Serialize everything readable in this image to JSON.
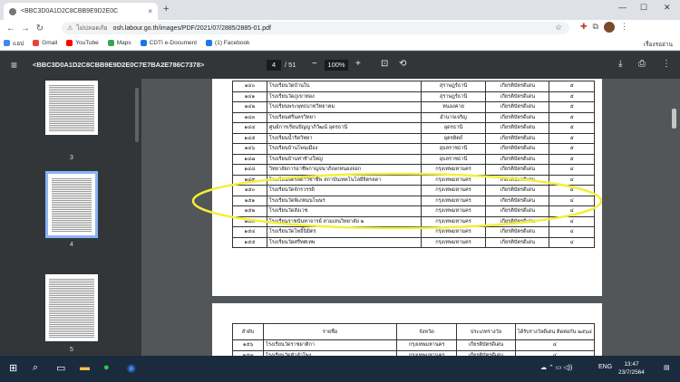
{
  "browser": {
    "tab_title": "<BBC3D0A1D2C8CBB9E9D2E0C",
    "tab_close": "×",
    "new_tab": "+",
    "win_min": "—",
    "win_max": "☐",
    "win_close": "✕",
    "back": "←",
    "forward": "→",
    "reload": "↻",
    "security_label": "ไม่ปลอดภัย",
    "url": "osh.labour.go.th/images/PDF/2021/07/2885/2885-01.pdf",
    "star": "☆"
  },
  "bookmarks": [
    {
      "label": "แอป",
      "color": "#4285f4"
    },
    {
      "label": "Gmail",
      "color": "#ea4335"
    },
    {
      "label": "YouTube",
      "color": "#ff0000"
    },
    {
      "label": "Maps",
      "color": "#34a853"
    },
    {
      "label": "CDTI e-Document",
      "color": "#1a73e8"
    },
    {
      "label": "(1) Facebook",
      "color": "#1877f2"
    }
  ],
  "bookmarks_right": "เรื่องรออ่าน",
  "pdf": {
    "menu_icon": "≡",
    "filename": "<BBC3D0A1D2C8CBB9E9D2E0C7E7BA2E786C7378>",
    "page_current": "4",
    "page_total": "/ 51",
    "zoom_out": "−",
    "zoom": "100%",
    "zoom_in": "+",
    "download": "⤓",
    "print": "⎙",
    "more": "⋮"
  },
  "thumbnails": [
    {
      "label": "3"
    },
    {
      "label": "4"
    },
    {
      "label": "5"
    }
  ],
  "page1_rows": [
    [
      "๑๔๐",
      "โรงเรียนวัดบ้านใน",
      "สุราษฎร์ธานี",
      "เกียรติบัตรดีเด่น",
      "๕"
    ],
    [
      "๑๔๑",
      "โรงเรียนวัดภูเขาทอง",
      "สุราษฎร์ธานี",
      "เกียรติบัตรดีเด่น",
      "๕"
    ],
    [
      "๑๔๒",
      "โรงเรียนพระพุทธบาทวิทยาคม",
      "หนองคาย",
      "เกียรติบัตรดีเด่น",
      "๕"
    ],
    [
      "๑๔๓",
      "โรงเรียนศรีนครวิทยา",
      "อำนาจเจริญ",
      "เกียรติบัตรดีเด่น",
      "๕"
    ],
    [
      "๑๔๔",
      "ศูนย์การเรียนปัญญาภิวัฒน์ อุดรธานี",
      "อุดรธานี",
      "เกียรติบัตรดีเด่น",
      "๕"
    ],
    [
      "๑๔๕",
      "โรงเรียนน้ำริดวิทยา",
      "อุตรดิตถ์",
      "เกียรติบัตรดีเด่น",
      "๕"
    ],
    [
      "๑๔๖",
      "โรงเรียนบ้านโพนเมือง",
      "อุบลราชธานี",
      "เกียรติบัตรดีเด่น",
      "๕"
    ],
    [
      "๑๔๗",
      "โรงเรียนบ้านท่าช้างใหญ่",
      "อุบลราชธานี",
      "เกียรติบัตรดีเด่น",
      "๕"
    ],
    [
      "๑๔๘",
      "วิทยาลัยการอาชีพกาญจนาภิเษกหนองจอก",
      "กรุงเทพมหานคร",
      "เกียรติบัตรดีเด่น",
      "๔"
    ],
    [
      "๑๔๙",
      "โรงเรียนจิตรลดาวิชาชีพ สถาบันเทคโนโลยีจิตรลดา",
      "กรุงเทพมหานคร",
      "เกียรติบัตรดีเด่น",
      "๔"
    ],
    [
      "๑๕๐",
      "โรงเรียนวัดจักรวรรดิ",
      "กรุงเทพมหานคร",
      "เกียรติบัตรดีเด่น",
      "๔"
    ],
    [
      "๑๕๑",
      "โรงเรียนวัดพิเภทมนโฆษร",
      "กรุงเทพมหานคร",
      "เกียรติบัตรดีเด่น",
      "๔"
    ],
    [
      "๑๕๒",
      "โรงเรียนวัดสังเวช",
      "กรุงเทพมหานคร",
      "เกียรติบัตรดีเด่น",
      "๔"
    ],
    [
      "๑๕๓",
      "โรงเรียนราชนันทาจารย์ สามเสนวิทยาลัย ๒",
      "กรุงเทพมหานคร",
      "เกียรติบัตรดีเด่น",
      "๔"
    ],
    [
      "๑๕๔",
      "โรงเรียนวัดโพธิ์นิมิตร",
      "กรุงเทพมหานคร",
      "เกียรติบัตรดีเด่น",
      "๔"
    ],
    [
      "๑๕๕",
      "โรงเรียนวัดศรีทศเทพ",
      "กรุงเทพมหานคร",
      "เกียรติบัตรดีเด่น",
      "๔"
    ]
  ],
  "page2_header": [
    "ลำดับ",
    "รายชื่อ",
    "จังหวัด",
    "ประเภทรางวัล",
    "ได้รับรางวัลดีเด่น ติดต่อกัน ๒๕๖๔"
  ],
  "page2_rows": [
    [
      "๑๕๖",
      "โรงเรียนวัดราชผาติกา",
      "กรุงเทพมหานคร",
      "เกียรติบัตรดีเด่น",
      "๔"
    ],
    [
      "๑๕๗",
      "โรงเรียนวัดหัวลำโพง",
      "กรุงเทพมหานคร",
      "เกียรติบัตรดีเด่น",
      "๔"
    ]
  ],
  "annotation_color": "#f3ef3a",
  "taskbar": {
    "start": "⊞",
    "search": "⌕",
    "tray_lang": "ENG",
    "time": "13:47",
    "date": "23/7/2564"
  }
}
